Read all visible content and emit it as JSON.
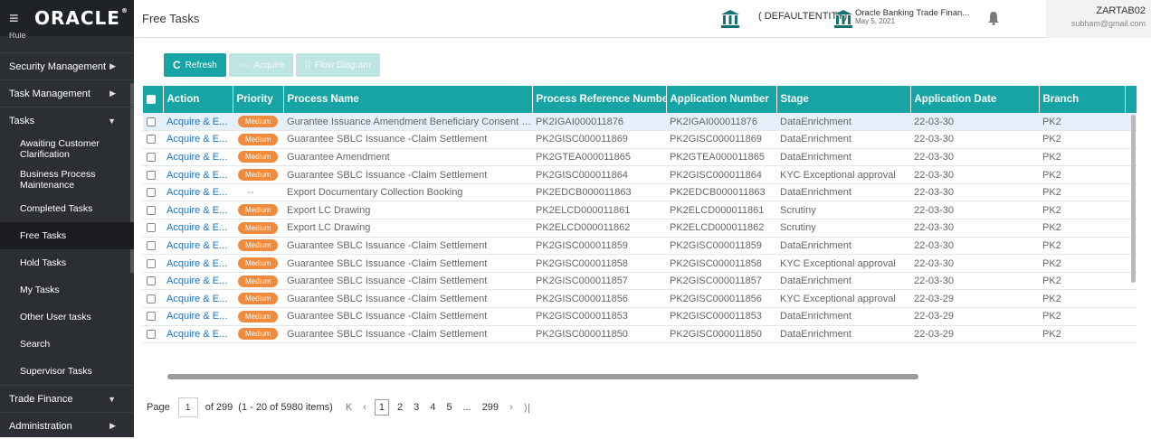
{
  "brand": {
    "menu_icon": "hamburger-icon",
    "logo_text": "ORACLE"
  },
  "sidebar": {
    "cut_item": "Rule",
    "items": [
      {
        "label": "Security Management",
        "has_chevron": true
      },
      {
        "label": "Task Management",
        "has_chevron": true
      },
      {
        "label": "Tasks",
        "expanded": true
      },
      {
        "label": "Awaiting Customer Clarification"
      },
      {
        "label": "Business Process Maintenance"
      },
      {
        "label": "Completed Tasks"
      },
      {
        "label": "Free Tasks",
        "active": true
      },
      {
        "label": "Hold Tasks"
      },
      {
        "label": "My Tasks"
      },
      {
        "label": "Other User tasks"
      },
      {
        "label": "Search"
      },
      {
        "label": "Supervisor Tasks"
      },
      {
        "label": "Trade Finance",
        "expanded": true
      },
      {
        "label": "Administration",
        "has_chevron": true
      }
    ]
  },
  "header": {
    "title": "Free Tasks",
    "entity": "( DEFAULTENTITY)",
    "app_name": "Oracle Banking Trade Finan...",
    "app_date": "May 5, 2021",
    "user_name": "ZARTAB02",
    "user_email": "subham@gmail.com"
  },
  "toolbar": {
    "refresh": "Refresh",
    "acquire": "Acquire",
    "flow_diagram": "Flow Diagram"
  },
  "table": {
    "columns": [
      "Action",
      "Priority",
      "Process Name",
      "Process Reference Number",
      "Application Number",
      "Stage",
      "Application Date",
      "Branch"
    ],
    "rows": [
      {
        "action": "Acquire & E...",
        "priority": "Medium",
        "process": "Gurantee Issuance Amendment Beneficiary Consent Isla...",
        "ref": "PK2IGAI000011876",
        "app": "PK2IGAI000011876",
        "stage": "DataEnrichment",
        "date": "22-03-30",
        "branch": "PK2"
      },
      {
        "action": "Acquire & E...",
        "priority": "Medium",
        "process": "Guarantee SBLC Issuance -Claim Settlement",
        "ref": "PK2GISC000011869",
        "app": "PK2GISC000011869",
        "stage": "DataEnrichment",
        "date": "22-03-30",
        "branch": "PK2"
      },
      {
        "action": "Acquire & E...",
        "priority": "Medium",
        "process": "Guarantee Amendment",
        "ref": "PK2GTEA000011865",
        "app": "PK2GTEA000011865",
        "stage": "DataEnrichment",
        "date": "22-03-30",
        "branch": "PK2"
      },
      {
        "action": "Acquire & E...",
        "priority": "Medium",
        "process": "Guarantee SBLC Issuance -Claim Settlement",
        "ref": "PK2GISC000011864",
        "app": "PK2GISC000011864",
        "stage": "KYC Exceptional approval",
        "date": "22-03-30",
        "branch": "PK2"
      },
      {
        "action": "Acquire & E...",
        "priority": "--",
        "process": "Export Documentary Collection Booking",
        "ref": "PK2EDCB000011863",
        "app": "PK2EDCB000011863",
        "stage": "DataEnrichment",
        "date": "22-03-30",
        "branch": "PK2"
      },
      {
        "action": "Acquire & E...",
        "priority": "Medium",
        "process": "Export LC Drawing",
        "ref": "PK2ELCD000011861",
        "app": "PK2ELCD000011861",
        "stage": "Scrutiny",
        "date": "22-03-30",
        "branch": "PK2"
      },
      {
        "action": "Acquire & E...",
        "priority": "Medium",
        "process": "Export LC Drawing",
        "ref": "PK2ELCD000011862",
        "app": "PK2ELCD000011862",
        "stage": "Scrutiny",
        "date": "22-03-30",
        "branch": "PK2"
      },
      {
        "action": "Acquire & E...",
        "priority": "Medium",
        "process": "Guarantee SBLC Issuance -Claim Settlement",
        "ref": "PK2GISC000011859",
        "app": "PK2GISC000011859",
        "stage": "DataEnrichment",
        "date": "22-03-30",
        "branch": "PK2"
      },
      {
        "action": "Acquire & E...",
        "priority": "Medium",
        "process": "Guarantee SBLC Issuance -Claim Settlement",
        "ref": "PK2GISC000011858",
        "app": "PK2GISC000011858",
        "stage": "KYC Exceptional approval",
        "date": "22-03-30",
        "branch": "PK2"
      },
      {
        "action": "Acquire & E...",
        "priority": "Medium",
        "process": "Guarantee SBLC Issuance -Claim Settlement",
        "ref": "PK2GISC000011857",
        "app": "PK2GISC000011857",
        "stage": "DataEnrichment",
        "date": "22-03-30",
        "branch": "PK2"
      },
      {
        "action": "Acquire & E...",
        "priority": "Medium",
        "process": "Guarantee SBLC Issuance -Claim Settlement",
        "ref": "PK2GISC000011856",
        "app": "PK2GISC000011856",
        "stage": "KYC Exceptional approval",
        "date": "22-03-29",
        "branch": "PK2"
      },
      {
        "action": "Acquire & E...",
        "priority": "Medium",
        "process": "Guarantee SBLC Issuance -Claim Settlement",
        "ref": "PK2GISC000011853",
        "app": "PK2GISC000011853",
        "stage": "DataEnrichment",
        "date": "22-03-29",
        "branch": "PK2"
      },
      {
        "action": "Acquire & E...",
        "priority": "Medium",
        "process": "Guarantee SBLC Issuance -Claim Settlement",
        "ref": "PK2GISC000011850",
        "app": "PK2GISC000011850",
        "stage": "DataEnrichment",
        "date": "22-03-29",
        "branch": "PK2"
      }
    ]
  },
  "pagination": {
    "page_label": "Page",
    "page_value": "1",
    "of_text": "of 299",
    "items_text": "(1 - 20 of 5980 items)",
    "pages": [
      "1",
      "2",
      "3",
      "4",
      "5",
      "...",
      "299"
    ],
    "current_page": "1"
  },
  "colors": {
    "teal": "#16a4a4",
    "orange": "#f08a3c",
    "link": "#1a73c0",
    "sidebar": "#2b2e33"
  }
}
